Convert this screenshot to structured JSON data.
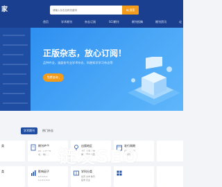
{
  "header": {
    "logo_text": "家",
    "search_placeholder": "请输入杂志名称关键词",
    "search_button": "搜索"
  },
  "nav": {
    "items": [
      "首页",
      "学术期刊",
      "杂志订阅",
      "SCI期刊",
      "期刊投稿",
      "期刊资讯",
      "论"
    ]
  },
  "sidebar": {
    "items": [
      "",
      "",
      "",
      "",
      "",
      "",
      "",
      "",
      "",
      "",
      ""
    ]
  },
  "banner": {
    "title": "正版杂志，放心订阅！",
    "subtitle": "品种齐全，涵盖各专业学术杂志、科普知识学习杂志等",
    "button": "免费咨询"
  },
  "tabs": {
    "active": "学术期刊",
    "second": "热门杂志"
  },
  "cards": [
    {
      "title": "类",
      "lines": [
        "",
        ""
      ]
    },
    {
      "title": "期刊收录",
      "lines": [
        "CSSCI  CSCD",
        "北大  统计源"
      ]
    },
    {
      "title": "出版地区",
      "lines": [
        "北京  上海  天津",
        "重庆  河北  山西"
      ]
    },
    {
      "title": "发行周期",
      "lines": [
        "月刊  双月刊",
        "半月刊"
      ]
    },
    {
      "title": "类",
      "lines": [
        "",
        ""
      ]
    },
    {
      "title": "影响因子",
      "lines": [
        "0.5  0.5-1",
        "1-1.5  1.5-2"
      ]
    },
    {
      "title": "学科分类",
      "lines": [
        "经济  文学  教育",
        "医学  农业"
      ]
    },
    {
      "title": "",
      "lines": [
        "",
        ""
      ]
    }
  ],
  "watermark": {
    "text": "链发SEO"
  },
  "colors": {
    "navy": "#1a3f8e",
    "accent": "#f39b1a",
    "banner": "#3c9cf4"
  }
}
